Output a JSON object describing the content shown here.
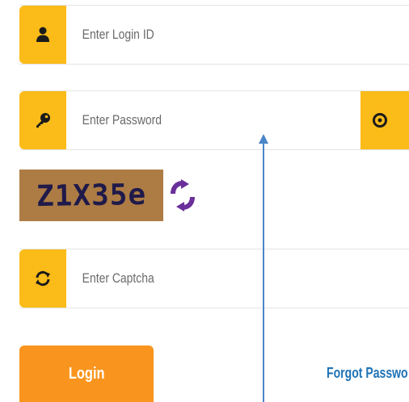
{
  "login_field": {
    "placeholder": "Enter Login ID",
    "value": "",
    "icon": "user-icon"
  },
  "password_field": {
    "placeholder": "Enter Password",
    "value": "",
    "icon": "key-icon",
    "toggle_icon": "eye-icon"
  },
  "captcha": {
    "text": "Z1X35e",
    "refresh_icon": "refresh-icon"
  },
  "captcha_field": {
    "placeholder": "Enter Captcha",
    "value": "",
    "icon": "sync-icon"
  },
  "actions": {
    "login_label": "Login",
    "forgot_label": "Forgot Passwo"
  },
  "colors": {
    "addon_yellow": "#fbbb18",
    "login_orange": "#f9951e",
    "captcha_bg": "#ad7c44",
    "captcha_text": "#1f1a4a",
    "refresh_purple": "#6a2f9a",
    "link_blue": "#1f73b6",
    "annotation_blue": "#4a86c8"
  }
}
